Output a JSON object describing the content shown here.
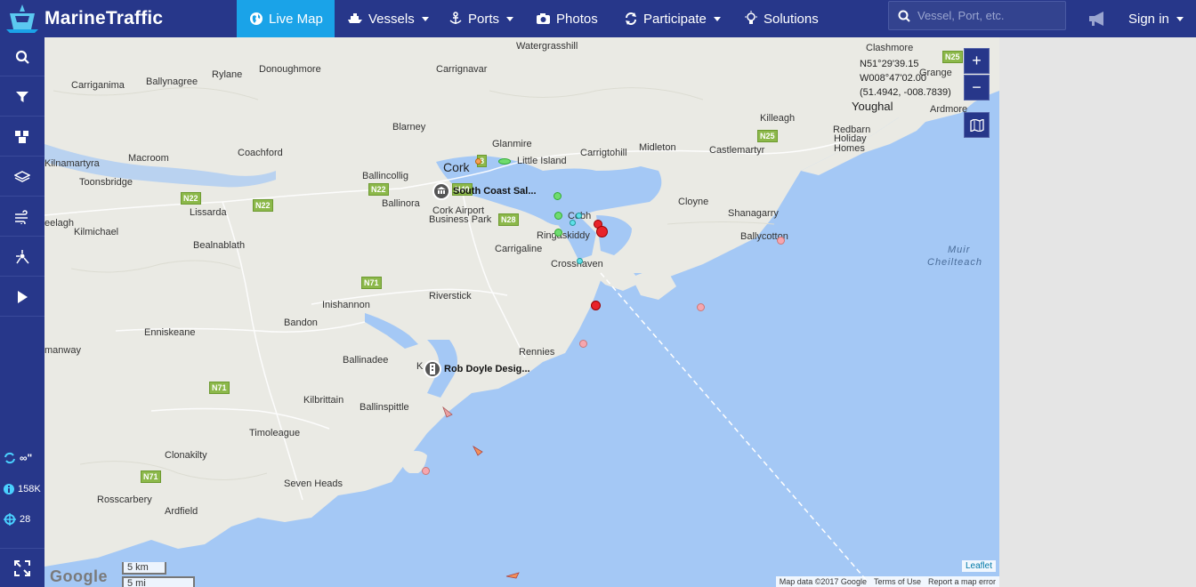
{
  "brand": {
    "name": "MarineTraffic"
  },
  "nav": {
    "live_map": "Live Map",
    "vessels": "Vessels",
    "ports": "Ports",
    "photos": "Photos",
    "participate": "Participate",
    "solutions": "Solutions",
    "sign_in": "Sign in"
  },
  "search": {
    "placeholder": "Vessel, Port, etc."
  },
  "sidebar": {
    "stats": {
      "sync": "∞\"",
      "vessels": "158K",
      "target": "28"
    }
  },
  "map": {
    "coords": {
      "lat": "N51°29'39.15",
      "lon": "W008°47'02.00",
      "decimal": "(51.4942, -008.7839)"
    },
    "zoom_in": "+",
    "zoom_out": "−",
    "scale_km": "5 km",
    "scale_mi": "5 mi",
    "google": "Google",
    "leaflet": "Leaflet",
    "attribution": {
      "data": "Map data ©2017 Google",
      "terms": "Terms of Use",
      "report": "Report a map error"
    },
    "sea_label_1": "Muir",
    "sea_label_2": "Cheilteach",
    "places": {
      "watergrasshill": "Watergrasshill",
      "clashmore": "Clashmore",
      "grange": "Grange",
      "rylane": "Rylane",
      "donoughmore": "Donoughmore",
      "carrignavar": "Carrignavar",
      "carriganima": "Carriganima",
      "ballynagree": "Ballynagree",
      "youghal": "Youghal",
      "ardmore": "Ardmore",
      "killeagh": "Killeagh",
      "blarney": "Blarney",
      "redbarn": "Redbarn",
      "holiday_homes_1": "Holiday",
      "holiday_homes_2": "Homes",
      "glanmire": "Glanmire",
      "midleton": "Midleton",
      "coachford": "Coachford",
      "carrigtohill": "Carrigtohill",
      "castlemartyr": "Castlemartyr",
      "kilnamartyra": "Kilnamartyra",
      "macroom": "Macroom",
      "cork": "Cork",
      "little_island": "Little Island",
      "ballincollig": "Ballincollig",
      "toonsbridge": "Toonsbridge",
      "ballinora": "Ballinora",
      "cork_airport_1": "Cork Airport",
      "cork_airport_2": "Business Park",
      "cobh": "Cobh",
      "cloyne": "Cloyne",
      "shanagarry": "Shanagarry",
      "lissarda": "Lissarda",
      "kilmichael": "Kilmichael",
      "ringaskiddy": "Ringaskiddy",
      "ballycotton": "Ballycotton",
      "beal": "eelagh",
      "bealnablath": "Bealnablath",
      "carrigaline": "Carrigaline",
      "crosshaven": "Crosshaven",
      "riverstick": "Riverstick",
      "inishannon": "Inishannon",
      "bandon": "Bandon",
      "enniskeane": "Enniskeane",
      "manway": "manway",
      "rennies": "Rennies",
      "ballinadee": "Ballinadee",
      "kilbrittain": "Kilbrittain",
      "ballinspittle": "Ballinspittle",
      "timoleague": "Timoleague",
      "clonakilty": "Clonakilty",
      "seven_heads": "Seven Heads",
      "rosscarbery": "Rosscarbery",
      "ardfield": "Ardfield"
    },
    "roads": {
      "n25a": "N25",
      "n25b": "N25",
      "n22a": "N22",
      "n22b": "N22",
      "n22c": "N22",
      "n28": "N28",
      "n71a": "N71",
      "n71b": "N71",
      "n71c": "N71",
      "r8": "8",
      "n40": "N40"
    },
    "pois": {
      "south_coast": "South Coast Sal...",
      "rob_doyle": "Rob Doyle Desig...",
      "kinsale": "K"
    }
  },
  "colors": {
    "topbar": "#27378a",
    "active_nav": "#1aa3e8",
    "sea": "#a4c8f5",
    "land": "#eaeae4",
    "vessel_red": "#e8232a",
    "vessel_pink": "#f6a6ae",
    "vessel_green": "#6fdc6f",
    "vessel_cyan": "#5fe0e8"
  }
}
